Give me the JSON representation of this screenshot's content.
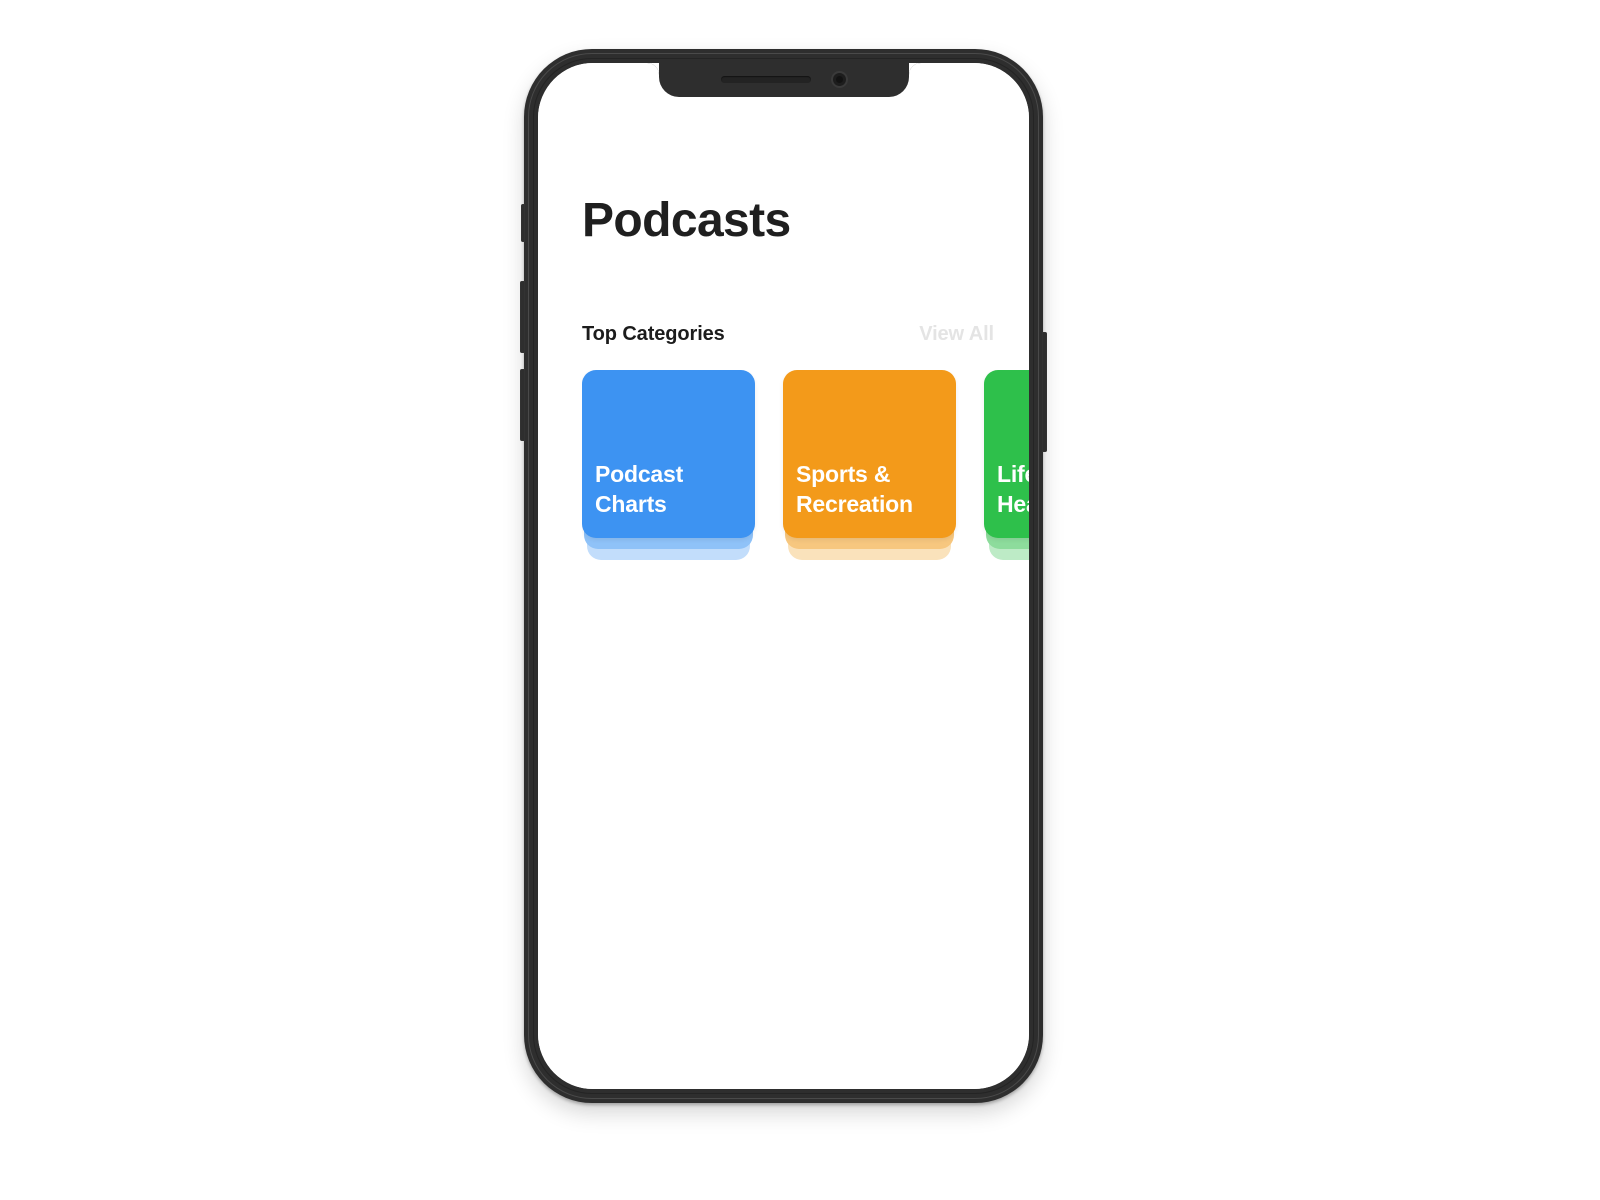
{
  "device": {
    "type": "smartphone-mockup",
    "notch": {
      "speaker_icon": "earpiece-speaker",
      "camera_icon": "front-camera"
    },
    "buttons": {
      "silent_switch": "silent-switch",
      "volume_up": "volume-up-button",
      "volume_down": "volume-down-button",
      "power": "power-button"
    }
  },
  "app": {
    "page_title": "Podcasts",
    "section": {
      "title": "Top Categories",
      "action_label": "View All"
    },
    "categories": [
      {
        "label": "Podcast\nCharts",
        "color": "#3d93f2",
        "shade_mid": "#8fc2f8",
        "shade_light": "#c2ddfb"
      },
      {
        "label": "Sports &\nRecreation",
        "color": "#f39a1a",
        "shade_mid": "#f7c77f",
        "shade_light": "#fae2bb"
      },
      {
        "label": "Life &\nHealth",
        "color": "#2ec04b",
        "shade_mid": "#8ddc9c",
        "shade_light": "#bdebc6"
      }
    ]
  },
  "colors": {
    "screen_background": "#ffffff",
    "frame": "#2e2e2e",
    "title_text": "#1f1f1f",
    "muted_text": "#e4e4e4"
  }
}
